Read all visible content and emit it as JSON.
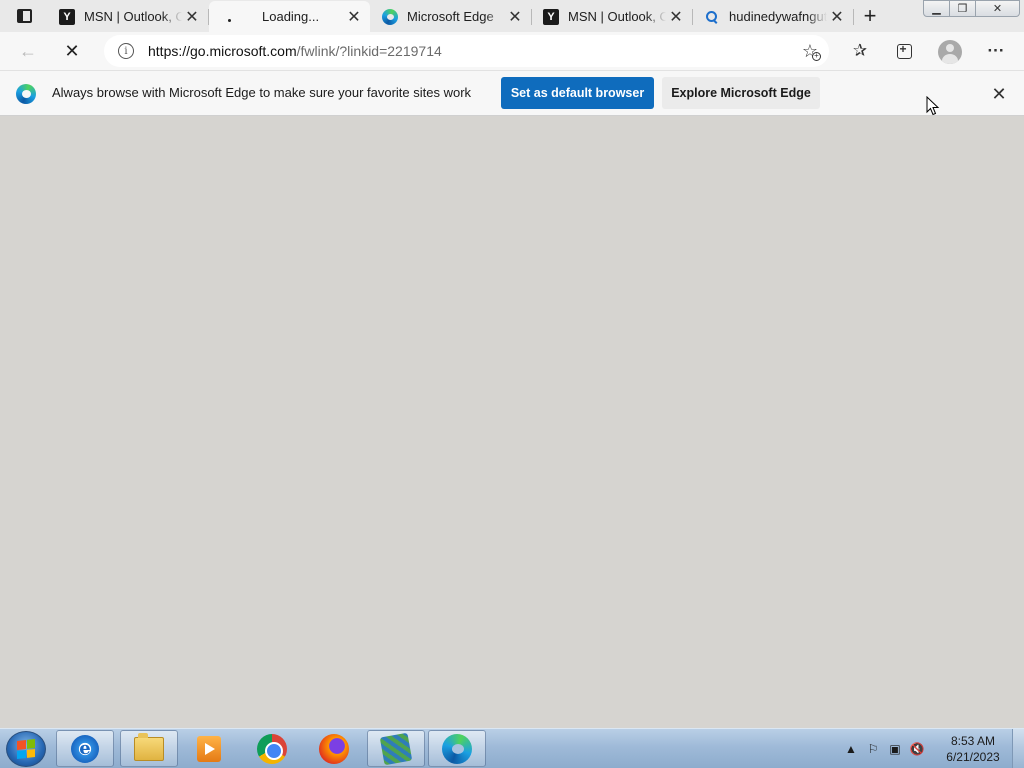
{
  "tabs": [
    {
      "title": "MSN | Outlook, Office, Skype, Bing",
      "icon": "msn-icon"
    },
    {
      "title": "Loading...",
      "icon": "loading-icon",
      "active": true
    },
    {
      "title": "Microsoft Edge",
      "icon": "edge-icon"
    },
    {
      "title": "MSN | Outlook, Office, Skype, Bing",
      "icon": "msn-icon"
    },
    {
      "title": "hudinedywafngutu",
      "icon": "search-icon"
    }
  ],
  "address_bar": {
    "url_host": "https://go.microsoft.com",
    "url_path": "/fwlink/?linkid=2219714"
  },
  "infobar": {
    "message": "Always browse with Microsoft Edge to make sure your favorite sites work",
    "primary_label": "Set as default browser",
    "secondary_label": "Explore Microsoft Edge"
  },
  "taskbar": {
    "apps": [
      "internet-explorer",
      "file-explorer",
      "media-player",
      "chrome",
      "firefox",
      "network-app",
      "edge"
    ],
    "time": "8:53 AM",
    "date": "6/21/2023"
  },
  "colors": {
    "accent": "#0f6cbd",
    "content_bg": "#d6d4d0",
    "tabbar_bg": "#e9e9e9"
  }
}
